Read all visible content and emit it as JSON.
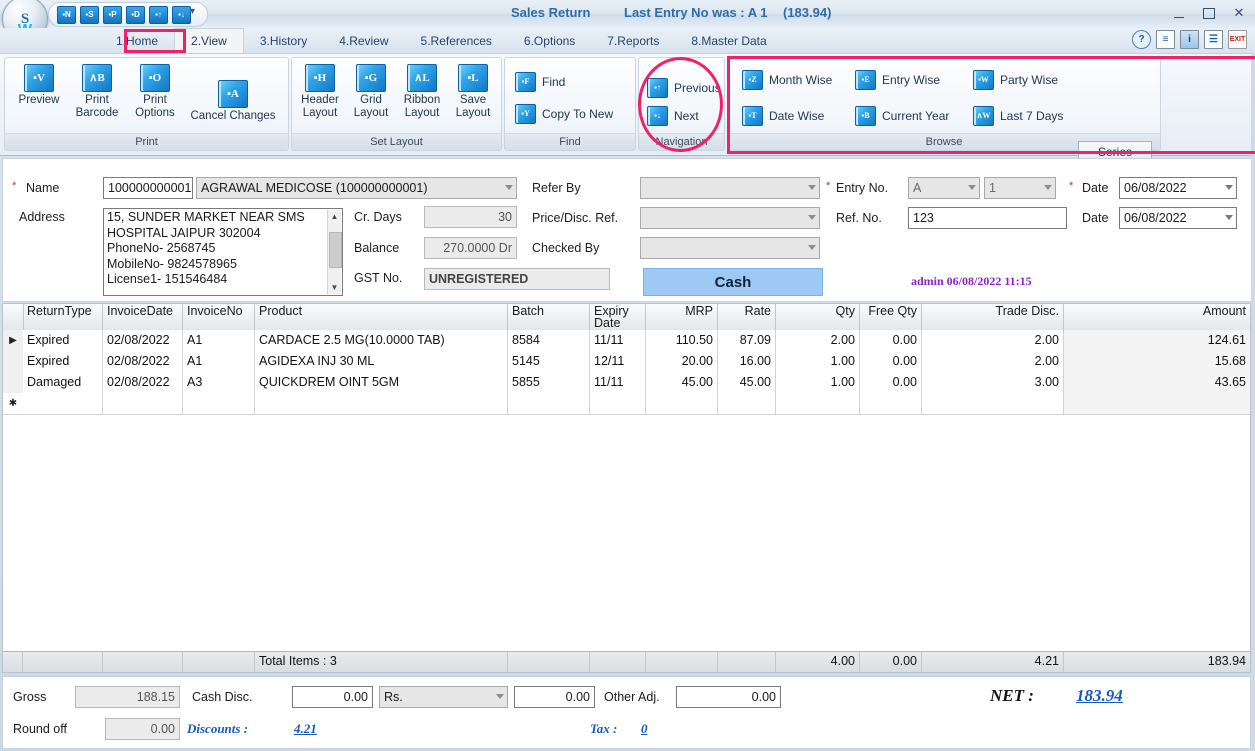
{
  "window": {
    "title_main": "Sales Return",
    "title_entry": "Last Entry No was : A 1",
    "title_amount": "(183.94)",
    "minimize": "–",
    "maximize": "□",
    "close": "✕"
  },
  "quick_access": {
    "buttons": [
      {
        "name": "new",
        "glyph": "▪N"
      },
      {
        "name": "save",
        "glyph": "▪S"
      },
      {
        "name": "print",
        "glyph": "▪P"
      },
      {
        "name": "delete",
        "glyph": "▪D"
      },
      {
        "name": "up",
        "glyph": "▪↑"
      },
      {
        "name": "down",
        "glyph": "▪↓"
      }
    ],
    "dropdown_glyph": "▾"
  },
  "tabs": [
    {
      "label": "1.Home",
      "selected": false
    },
    {
      "label": "2.View",
      "selected": true
    },
    {
      "label": "3.History",
      "selected": false
    },
    {
      "label": "4.Review",
      "selected": false
    },
    {
      "label": "5.References",
      "selected": false
    },
    {
      "label": "6.Options",
      "selected": false
    },
    {
      "label": "7.Reports",
      "selected": false
    },
    {
      "label": "8.Master Data",
      "selected": false
    }
  ],
  "top_icons": [
    {
      "name": "help-icon",
      "glyph": "?"
    },
    {
      "name": "about-icon",
      "glyph": "≡"
    },
    {
      "name": "info-icon",
      "glyph": "i"
    },
    {
      "name": "document-icon",
      "glyph": "☰"
    },
    {
      "name": "exit-icon",
      "glyph": "EXIT"
    }
  ],
  "ribbon": {
    "groups": [
      {
        "name": "Print",
        "label": "Print",
        "buttons": [
          {
            "label_line1": "Preview",
            "label_line2": "",
            "icon": "▪V"
          },
          {
            "label_line1": "Print",
            "label_line2": "Barcode",
            "icon": "∧B"
          },
          {
            "label_line1": "Print",
            "label_line2": "Options",
            "icon": "▪O"
          },
          {
            "label_line1": "Cancel Changes",
            "label_line2": "",
            "icon": "▪A"
          }
        ]
      },
      {
        "name": "Set Layout",
        "label": "Set Layout",
        "buttons": [
          {
            "label_line1": "Header",
            "label_line2": "Layout",
            "icon": "▪H"
          },
          {
            "label_line1": "Grid",
            "label_line2": "Layout",
            "icon": "▪G"
          },
          {
            "label_line1": "Ribbon",
            "label_line2": "Layout",
            "icon": "∧L"
          },
          {
            "label_line1": "Save",
            "label_line2": "Layout",
            "icon": "▪L"
          }
        ]
      },
      {
        "name": "Find",
        "label": "Find",
        "buttons": [
          {
            "label": "Find",
            "icon": "▪F"
          },
          {
            "label": "Copy To New",
            "icon": "▪Y"
          }
        ]
      },
      {
        "name": "Navigation",
        "label": "Navigation",
        "buttons": [
          {
            "label": "Previous",
            "icon": "▪↑"
          },
          {
            "label": "Next",
            "icon": "▪↓"
          }
        ]
      },
      {
        "name": "Browse",
        "label": "Browse",
        "buttons": [
          {
            "label": "Month Wise",
            "icon": "▪Z"
          },
          {
            "label": "Entry Wise",
            "icon": "▪E"
          },
          {
            "label": "Party Wise",
            "icon": "▪W"
          },
          {
            "label": "Date Wise",
            "icon": "▪T"
          },
          {
            "label": "Current Year",
            "icon": "▪B"
          },
          {
            "label": "Last 7 Days",
            "icon": "∧W"
          }
        ]
      }
    ],
    "series_button": "Series"
  },
  "form": {
    "name_label": "Name",
    "name_code": "100000000001",
    "name_value": "AGRAWAL MEDICOSE (100000000001)",
    "address_label": "Address",
    "address_value": "15, SUNDER MARKET NEAR SMS HOSPITAL JAIPUR 302004\n PhoneNo- 2568745\n MobileNo- 9824578965\nLicense1- 151546484",
    "address_lines": [
      "15, SUNDER MARKET NEAR SMS",
      "HOSPITAL JAIPUR 302004",
      " PhoneNo- 2568745",
      " MobileNo- 9824578965",
      "License1- 151546484"
    ],
    "cr_days_label": "Cr. Days",
    "cr_days_value": "30",
    "balance_label": "Balance",
    "balance_value": "270.0000 Dr",
    "gst_label": "GST No.",
    "gst_value": "UNREGISTERED",
    "refer_by_label": "Refer By",
    "refer_by_value": "",
    "price_disc_label": "Price/Disc. Ref.",
    "price_disc_value": "",
    "checked_by_label": "Checked By",
    "checked_by_value": "",
    "cash_button": "Cash",
    "entry_no_label": "Entry No.",
    "entry_no_series": "A",
    "entry_no_number": "1",
    "ref_no_label": "Ref. No.",
    "ref_no_value": "123",
    "date_label_1": "Date",
    "date_value_1": "06/08/2022",
    "date_label_2": "Date",
    "date_value_2": "06/08/2022",
    "audit_stamp": "admin 06/08/2022 11:15"
  },
  "grid": {
    "columns": [
      {
        "key": "ReturnType",
        "label": "ReturnType",
        "align": "left"
      },
      {
        "key": "InvoiceDate",
        "label": "InvoiceDate",
        "align": "left"
      },
      {
        "key": "InvoiceNo",
        "label": "InvoiceNo",
        "align": "left"
      },
      {
        "key": "Product",
        "label": "Product",
        "align": "left"
      },
      {
        "key": "Batch",
        "label": "Batch",
        "align": "left"
      },
      {
        "key": "ExpiryDate",
        "label": "Expiry Date",
        "align": "left"
      },
      {
        "key": "MRP",
        "label": "MRP",
        "align": "right"
      },
      {
        "key": "Rate",
        "label": "Rate",
        "align": "right"
      },
      {
        "key": "Qty",
        "label": "Qty",
        "align": "right"
      },
      {
        "key": "FreeQty",
        "label": "Free Qty",
        "align": "right"
      },
      {
        "key": "TradeDisc",
        "label": "Trade Disc.",
        "align": "right"
      },
      {
        "key": "Amount",
        "label": "Amount",
        "align": "right"
      }
    ],
    "rows": [
      {
        "selected": true,
        "ReturnType": "Expired",
        "InvoiceDate": "02/08/2022",
        "InvoiceNo": "A1",
        "Product": "CARDACE 2.5 MG(10.0000 TAB)",
        "Batch": "8584",
        "ExpiryDate": "11/11",
        "MRP": "110.50",
        "Rate": "87.09",
        "Qty": "2.00",
        "FreeQty": "0.00",
        "TradeDisc": "2.00",
        "Amount": "124.61"
      },
      {
        "selected": false,
        "ReturnType": "Expired",
        "InvoiceDate": "02/08/2022",
        "InvoiceNo": "A1",
        "Product": "AGIDEXA INJ 30 ML",
        "Batch": "5145",
        "ExpiryDate": "12/11",
        "MRP": "20.00",
        "Rate": "16.00",
        "Qty": "1.00",
        "FreeQty": "0.00",
        "TradeDisc": "2.00",
        "Amount": "15.68"
      },
      {
        "selected": false,
        "ReturnType": "Damaged",
        "InvoiceDate": "02/08/2022",
        "InvoiceNo": "A3",
        "Product": "QUICKDREM OINT 5GM",
        "Batch": "5855",
        "ExpiryDate": "11/11",
        "MRP": "45.00",
        "Rate": "45.00",
        "Qty": "1.00",
        "FreeQty": "0.00",
        "TradeDisc": "3.00",
        "Amount": "43.65"
      },
      {
        "selected": false,
        "new_row": true,
        "ReturnType": "",
        "InvoiceDate": "",
        "InvoiceNo": "",
        "Product": "",
        "Batch": "",
        "ExpiryDate": "",
        "MRP": "",
        "Rate": "",
        "Qty": "",
        "FreeQty": "",
        "TradeDisc": "",
        "Amount": ""
      }
    ],
    "row_markers": {
      "current": "▶",
      "new": "✱"
    },
    "footer": {
      "total_items": "Total Items : 3",
      "qty": "4.00",
      "free_qty": "0.00",
      "trade_disc": "4.21",
      "amount": "183.94"
    }
  },
  "totals": {
    "gross_label": "Gross",
    "gross_value": "188.15",
    "round_off_label": "Round off",
    "round_off_value": "0.00",
    "cash_disc_label": "Cash Disc.",
    "cash_disc_value": "0.00",
    "cash_disc_unit": "Rs.",
    "cash_disc_amount": "0.00",
    "other_adj_label": "Other Adj.",
    "other_adj_value": "0.00",
    "discounts_label": "Discounts :",
    "discounts_value": "4.21",
    "tax_label": "Tax :",
    "tax_value": "0",
    "net_label": "NET :",
    "net_value": "183.94"
  },
  "colors": {
    "accent": "#2b6cad",
    "highlight": "#f0206b",
    "link": "#1659c0",
    "stamp": "#8b23c7",
    "cash": "#9fc9f5"
  }
}
